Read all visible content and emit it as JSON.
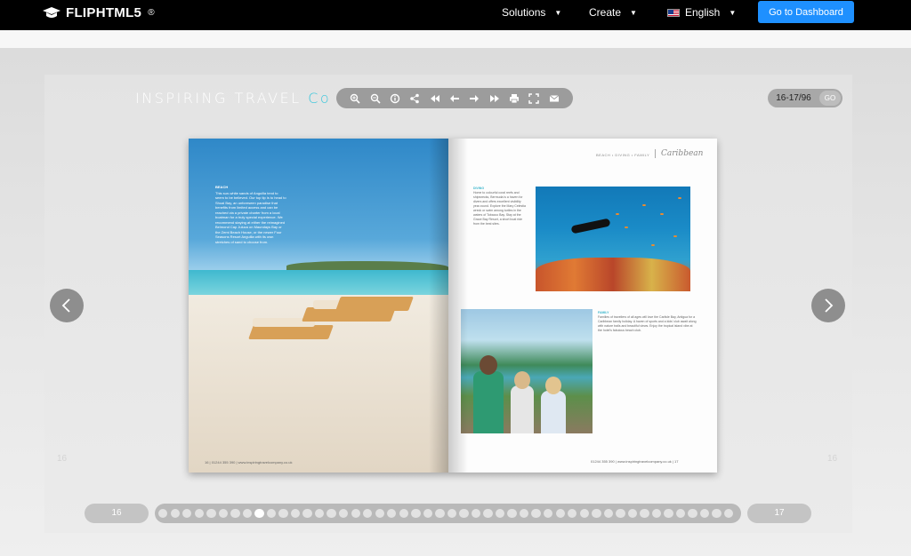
{
  "nav": {
    "logo_text": "FLIPHTML5",
    "logo_mark": "®",
    "solutions_label": "Solutions",
    "create_label": "Create",
    "language_label": "English",
    "dashboard_label": "Go to Dashboard"
  },
  "viewer": {
    "brand_title": "INSPIRING TRAVEL ",
    "brand_co": "Co",
    "toolbar_icons": [
      "zoom-in-icon",
      "zoom-out-icon",
      "info-icon",
      "share-icon",
      "first-page-icon",
      "prev-page-icon",
      "next-page-icon",
      "last-page-icon",
      "print-icon",
      "fullscreen-icon",
      "mail-icon"
    ],
    "page_indicator": "16-17/96",
    "go_label": "GO",
    "ghost_left": "16",
    "ghost_right": "16",
    "prev_page_label": "16",
    "next_page_label": "17",
    "thumb_count": 48,
    "active_thumb": 8
  },
  "book": {
    "left_heading": "BEACH",
    "left_text": "This sun-white sands of Anguilla tend to seem to be believed. Our top tip is to head to Shoal Bay, an unforeseen paradise that benefits from limited access and can be reached via a private charter from a local boatman for a truly special experience. We recommend staying at either the reimagined Belmond Cap Juluca on Maundays Bay or the Zemi Beach House, or the newer Four Seasons Resort Anguilla with its own stretches of sand to choose from.",
    "left_footer": "16  |  01244 355 390  |  www.inspiringtravelcompany.co.uk",
    "right_header": "BEACH • DIVING • FAMILY",
    "right_script": "Caribbean",
    "right_heading_1": "DIVING",
    "right_text_1": "Home to colourful coral reefs and shipwrecks, Bermuda is a haven for divers and offers excellent visibility year-round. Explore the Mary Celestia wreck or swim among turtles in the waters of Tobacco Bay. Stay at the Grace Bay Resort, a short boat ride from the best sites.",
    "right_heading_2": "FAMILY",
    "right_text_2": "Families of travellers of all ages will love the Carlisle Bay, Antigua for a Caribbean family holiday. A haven of sports and a kids' club await along with nature trails and beautiful views. Enjoy the tropical island vibe at the hotel's fabulous beach club.",
    "right_footer": "01244 355 390  |  www.inspiringtravelcompany.co.uk  |  17"
  },
  "colors": {
    "accent": "#3cc7dc",
    "dashboard_button": "#1e90ff",
    "toolbar_bg": "#9c9c9c"
  }
}
